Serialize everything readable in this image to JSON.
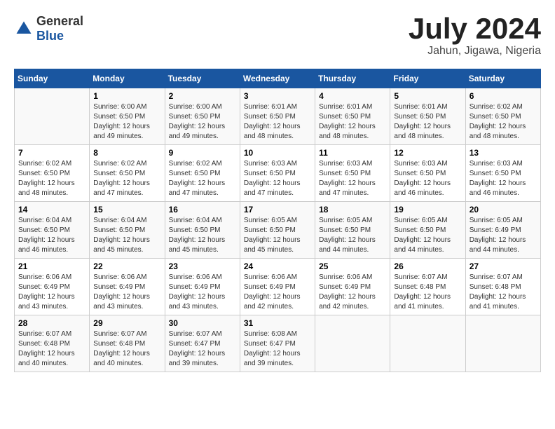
{
  "header": {
    "logo_general": "General",
    "logo_blue": "Blue",
    "month_title": "July 2024",
    "location": "Jahun, Jigawa, Nigeria"
  },
  "days_of_week": [
    "Sunday",
    "Monday",
    "Tuesday",
    "Wednesday",
    "Thursday",
    "Friday",
    "Saturday"
  ],
  "weeks": [
    [
      {
        "day": "",
        "info": ""
      },
      {
        "day": "1",
        "info": "Sunrise: 6:00 AM\nSunset: 6:50 PM\nDaylight: 12 hours and 49 minutes."
      },
      {
        "day": "2",
        "info": "Sunrise: 6:00 AM\nSunset: 6:50 PM\nDaylight: 12 hours and 49 minutes."
      },
      {
        "day": "3",
        "info": "Sunrise: 6:01 AM\nSunset: 6:50 PM\nDaylight: 12 hours and 48 minutes."
      },
      {
        "day": "4",
        "info": "Sunrise: 6:01 AM\nSunset: 6:50 PM\nDaylight: 12 hours and 48 minutes."
      },
      {
        "day": "5",
        "info": "Sunrise: 6:01 AM\nSunset: 6:50 PM\nDaylight: 12 hours and 48 minutes."
      },
      {
        "day": "6",
        "info": "Sunrise: 6:02 AM\nSunset: 6:50 PM\nDaylight: 12 hours and 48 minutes."
      }
    ],
    [
      {
        "day": "7",
        "info": "Sunrise: 6:02 AM\nSunset: 6:50 PM\nDaylight: 12 hours and 48 minutes."
      },
      {
        "day": "8",
        "info": "Sunrise: 6:02 AM\nSunset: 6:50 PM\nDaylight: 12 hours and 47 minutes."
      },
      {
        "day": "9",
        "info": "Sunrise: 6:02 AM\nSunset: 6:50 PM\nDaylight: 12 hours and 47 minutes."
      },
      {
        "day": "10",
        "info": "Sunrise: 6:03 AM\nSunset: 6:50 PM\nDaylight: 12 hours and 47 minutes."
      },
      {
        "day": "11",
        "info": "Sunrise: 6:03 AM\nSunset: 6:50 PM\nDaylight: 12 hours and 47 minutes."
      },
      {
        "day": "12",
        "info": "Sunrise: 6:03 AM\nSunset: 6:50 PM\nDaylight: 12 hours and 46 minutes."
      },
      {
        "day": "13",
        "info": "Sunrise: 6:03 AM\nSunset: 6:50 PM\nDaylight: 12 hours and 46 minutes."
      }
    ],
    [
      {
        "day": "14",
        "info": "Sunrise: 6:04 AM\nSunset: 6:50 PM\nDaylight: 12 hours and 46 minutes."
      },
      {
        "day": "15",
        "info": "Sunrise: 6:04 AM\nSunset: 6:50 PM\nDaylight: 12 hours and 45 minutes."
      },
      {
        "day": "16",
        "info": "Sunrise: 6:04 AM\nSunset: 6:50 PM\nDaylight: 12 hours and 45 minutes."
      },
      {
        "day": "17",
        "info": "Sunrise: 6:05 AM\nSunset: 6:50 PM\nDaylight: 12 hours and 45 minutes."
      },
      {
        "day": "18",
        "info": "Sunrise: 6:05 AM\nSunset: 6:50 PM\nDaylight: 12 hours and 44 minutes."
      },
      {
        "day": "19",
        "info": "Sunrise: 6:05 AM\nSunset: 6:50 PM\nDaylight: 12 hours and 44 minutes."
      },
      {
        "day": "20",
        "info": "Sunrise: 6:05 AM\nSunset: 6:49 PM\nDaylight: 12 hours and 44 minutes."
      }
    ],
    [
      {
        "day": "21",
        "info": "Sunrise: 6:06 AM\nSunset: 6:49 PM\nDaylight: 12 hours and 43 minutes."
      },
      {
        "day": "22",
        "info": "Sunrise: 6:06 AM\nSunset: 6:49 PM\nDaylight: 12 hours and 43 minutes."
      },
      {
        "day": "23",
        "info": "Sunrise: 6:06 AM\nSunset: 6:49 PM\nDaylight: 12 hours and 43 minutes."
      },
      {
        "day": "24",
        "info": "Sunrise: 6:06 AM\nSunset: 6:49 PM\nDaylight: 12 hours and 42 minutes."
      },
      {
        "day": "25",
        "info": "Sunrise: 6:06 AM\nSunset: 6:49 PM\nDaylight: 12 hours and 42 minutes."
      },
      {
        "day": "26",
        "info": "Sunrise: 6:07 AM\nSunset: 6:48 PM\nDaylight: 12 hours and 41 minutes."
      },
      {
        "day": "27",
        "info": "Sunrise: 6:07 AM\nSunset: 6:48 PM\nDaylight: 12 hours and 41 minutes."
      }
    ],
    [
      {
        "day": "28",
        "info": "Sunrise: 6:07 AM\nSunset: 6:48 PM\nDaylight: 12 hours and 40 minutes."
      },
      {
        "day": "29",
        "info": "Sunrise: 6:07 AM\nSunset: 6:48 PM\nDaylight: 12 hours and 40 minutes."
      },
      {
        "day": "30",
        "info": "Sunrise: 6:07 AM\nSunset: 6:47 PM\nDaylight: 12 hours and 39 minutes."
      },
      {
        "day": "31",
        "info": "Sunrise: 6:08 AM\nSunset: 6:47 PM\nDaylight: 12 hours and 39 minutes."
      },
      {
        "day": "",
        "info": ""
      },
      {
        "day": "",
        "info": ""
      },
      {
        "day": "",
        "info": ""
      }
    ]
  ]
}
